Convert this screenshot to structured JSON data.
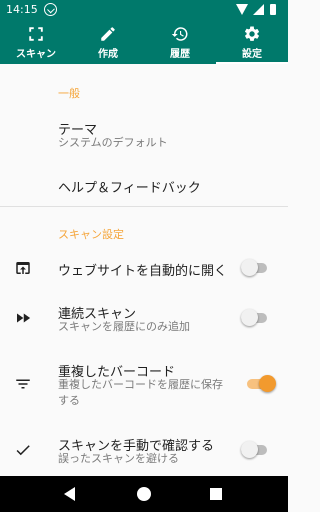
{
  "status_bar": {
    "time": "14:15"
  },
  "tabs": [
    {
      "label": "スキャン",
      "icon": "scan-frame-icon",
      "active": false
    },
    {
      "label": "作成",
      "icon": "pencil-icon",
      "active": false
    },
    {
      "label": "履歴",
      "icon": "history-icon",
      "active": false
    },
    {
      "label": "設定",
      "icon": "gear-icon",
      "active": true
    }
  ],
  "general": {
    "header": "一般",
    "theme": {
      "title": "テーマ",
      "summary": "システムのデフォルト"
    },
    "help": {
      "title": "ヘルプ＆フィードバック"
    }
  },
  "scan_settings": {
    "header": "スキャン設定",
    "open_website": {
      "title": "ウェブサイトを自動的に開く",
      "icon": "open-in-browser-icon",
      "enabled": false
    },
    "continuous_scan": {
      "title": "連続スキャン",
      "summary": "スキャンを履歴にのみ追加",
      "icon": "fast-forward-icon",
      "enabled": false
    },
    "duplicate_barcode": {
      "title": "重複したバーコード",
      "summary": "重複したバーコードを履歴に保存する",
      "icon": "filter-icon",
      "enabled": true
    },
    "manual_confirm": {
      "title": "スキャンを手動で確認する",
      "summary": "誤ったスキャンを避ける",
      "icon": "check-icon",
      "enabled": false
    }
  },
  "colors": {
    "primary": "#00796b",
    "accent": "#f29a2e",
    "background": "#fafafa"
  }
}
